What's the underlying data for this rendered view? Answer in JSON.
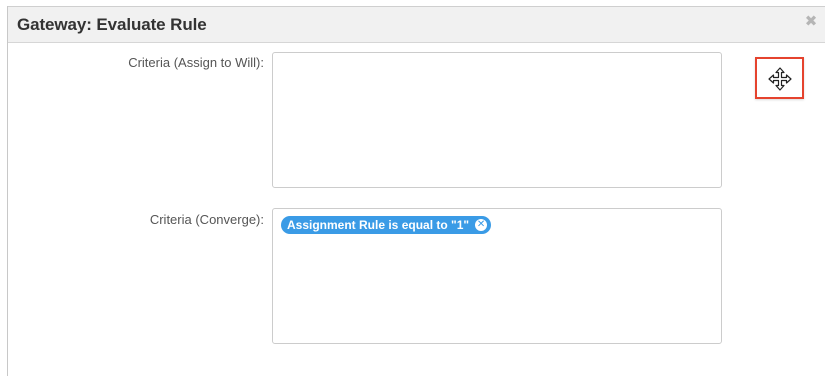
{
  "dialog": {
    "title": "Gateway: Evaluate Rule",
    "close_icon": "close-icon",
    "move_icon": "move-arrows-icon",
    "highlight_color": "#e5432e",
    "accent_color": "#3a9be6"
  },
  "fields": {
    "assign": {
      "label": "Criteria (Assign to Will):",
      "value": ""
    },
    "converge": {
      "label": "Criteria (Converge):",
      "tags": [
        {
          "text": "Assignment Rule is equal to \"1\"",
          "remove_icon": "remove-tag-icon"
        }
      ]
    }
  }
}
